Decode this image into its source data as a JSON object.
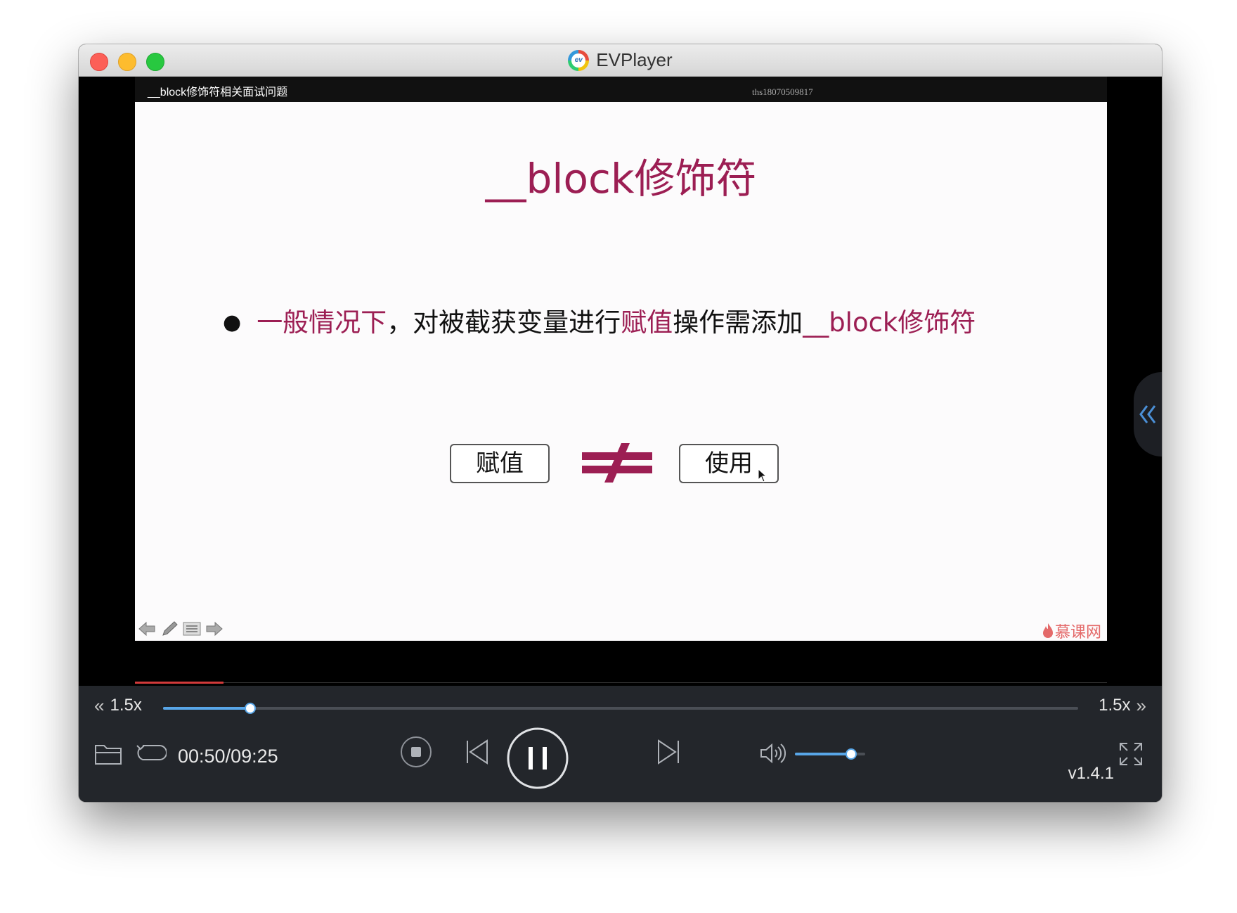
{
  "window": {
    "title": "EVPlayer"
  },
  "video": {
    "title": "__block修饰符相关面试问题",
    "watermark_id": "ths18070509817",
    "played_fraction": 0.09
  },
  "slide": {
    "title": "__block修饰符",
    "bullet": {
      "part1": "一般情况下",
      "part2": "，对被截获变量进行",
      "part3": "赋值",
      "part4": "操作需添加",
      "part5": "__block修饰符"
    },
    "box_left": "赋值",
    "box_right": "使用",
    "brand": "慕课网",
    "accent_color": "#9c1e53"
  },
  "controls": {
    "speed_left": "1.5x",
    "speed_right": "1.5x",
    "time": "00:50/09:25",
    "seek_fraction": 0.095,
    "volume_fraction": 0.8,
    "version": "v1.4.1",
    "accent_color": "#58a6e8"
  }
}
